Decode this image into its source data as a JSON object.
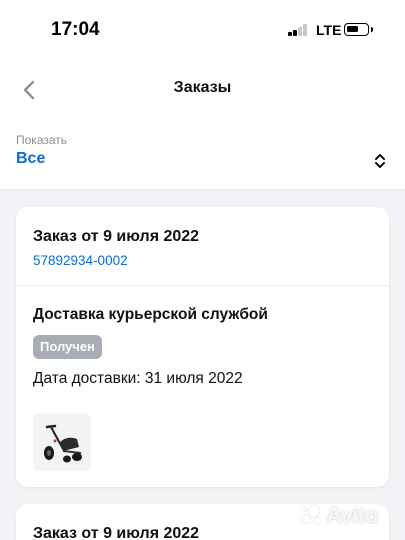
{
  "status_bar": {
    "time": "17:04",
    "network": "LTE"
  },
  "nav": {
    "title": "Заказы",
    "back_icon": "chevron-left-icon"
  },
  "filter": {
    "label": "Показать",
    "value": "Все",
    "icon": "chevron-up-down-icon"
  },
  "orders": [
    {
      "title": "Заказ от 9 июля 2022",
      "number": "57892934-0002",
      "delivery_method": "Доставка курьерской службой",
      "status": "Получен",
      "delivery_date": "Дата доставки: 31 июля 2022",
      "item_image": "drift-trike-photo"
    },
    {
      "title": "Заказ от 9 июля 2022"
    }
  ],
  "watermark": "Avito",
  "colors": {
    "accent": "#0a6cd6",
    "status_badge": "#a8adb5",
    "background": "#f2f3f6"
  }
}
